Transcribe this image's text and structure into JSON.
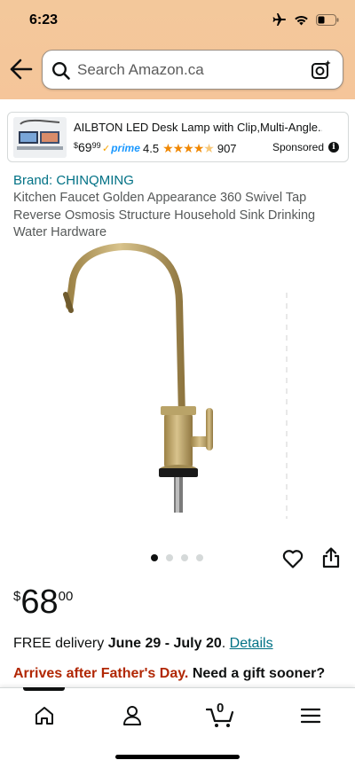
{
  "status_bar": {
    "time": "6:23"
  },
  "search": {
    "placeholder": "Search Amazon.ca"
  },
  "ad": {
    "title": "AILBTON LED Desk Lamp with Clip,Multi-Angle...",
    "price_symbol": "$",
    "price_whole": "69",
    "price_fraction": "99",
    "prime_label": "prime",
    "rating": "4.5",
    "review_count": "907",
    "sponsored_label": "Sponsored",
    "info_glyph": "i"
  },
  "product": {
    "brand": "Brand: CHINQMING",
    "title": "Kitchen Faucet Golden Appearance 360 Swivel Tap Reverse Osmosis Structure Household Sink Drinking Water Hardware",
    "image_count": 4,
    "active_image": 0,
    "price_symbol": "$",
    "price_whole": "68",
    "price_fraction": "00"
  },
  "delivery": {
    "prefix": "FREE delivery ",
    "dates": "June 29 - July 20",
    "suffix": ". ",
    "details_link": "Details"
  },
  "arrival": {
    "warning": "Arrives after Father's Day.",
    "prompt": " Need a gift sooner?"
  },
  "bottom_nav": {
    "items": [
      "home-icon",
      "account-icon",
      "cart-icon",
      "menu-icon"
    ],
    "cart_count": "0"
  },
  "colors": {
    "header_bg": "#f3c89b",
    "link": "#007185",
    "price_text": "#0f1111",
    "alert_red": "#b12704",
    "star": "#f08804",
    "prime_blue": "#1a98ff"
  }
}
